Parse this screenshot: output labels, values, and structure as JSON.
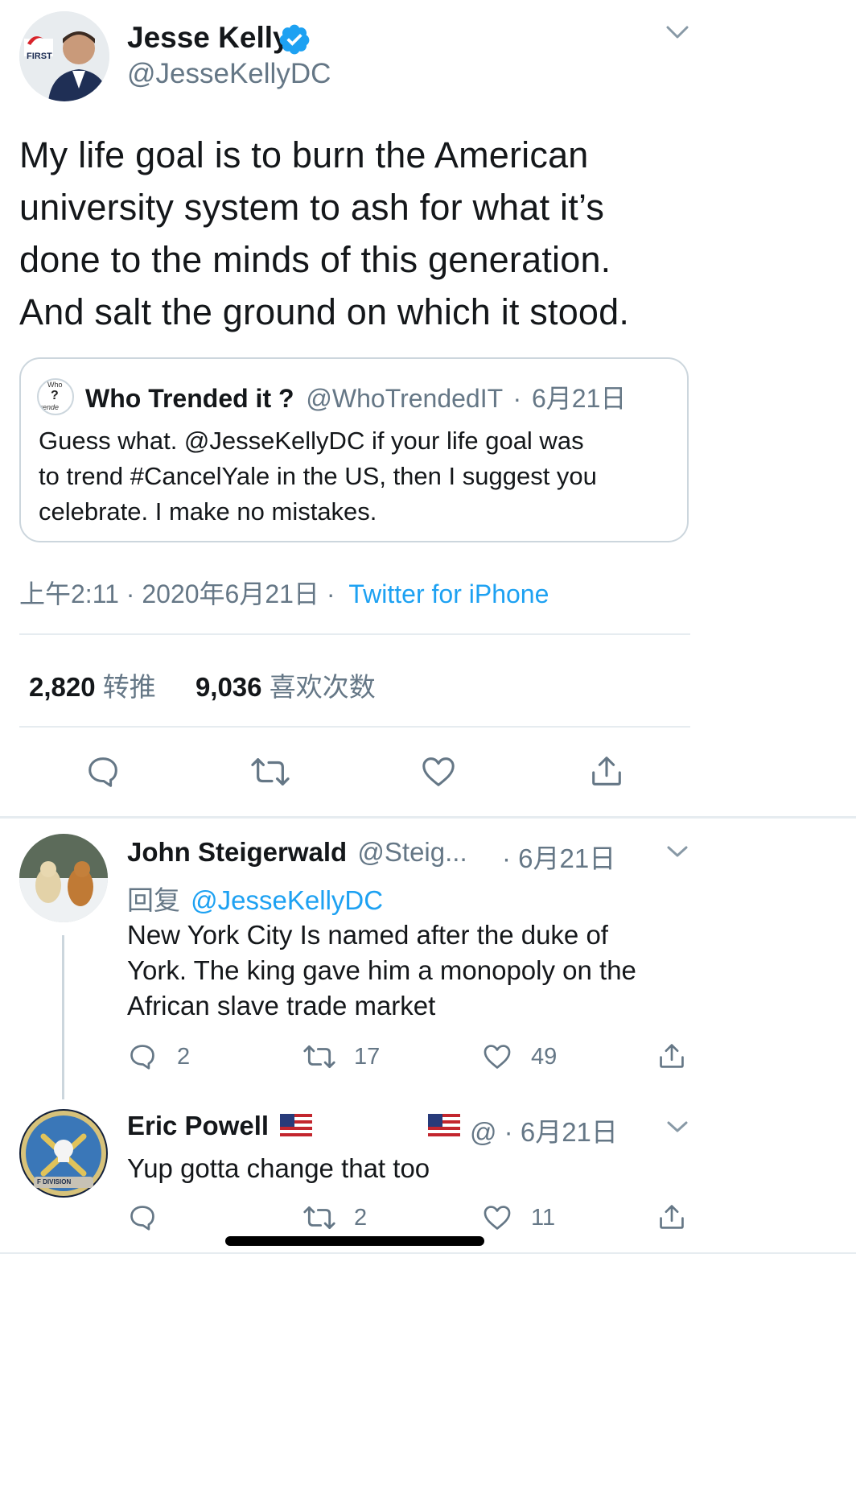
{
  "main_tweet": {
    "author_name": "Jesse Kelly",
    "author_handle": "@JesseKellyDC",
    "avatar_badge_text": "FIRST",
    "text_lines": [
      "My life goal is to burn the American",
      "university system to ash for what it’s",
      "done to the minds of this generation.",
      "And salt the ground on which it stood."
    ],
    "quoted": {
      "avatar_text_top": "Who",
      "avatar_text_mid": "?",
      "avatar_text_bot": "rende",
      "name": "Who Trended it ?",
      "handle": "@WhoTrendedIT",
      "separator": "·",
      "date": "6月21日",
      "text_lines": [
        "Guess what. @JesseKellyDC if your life goal was",
        "to trend #CancelYale in the US, then I suggest you",
        "celebrate. I make no mistakes."
      ]
    },
    "timestamp": "上午2:11 · 2020年6月21日 ·",
    "source": "Twitter for iPhone",
    "retweets_count": "2,820",
    "retweets_label": "转推",
    "likes_count": "9,036",
    "likes_label": "喜欢次数"
  },
  "replies": [
    {
      "name": "John Steigerwald",
      "handle": "@Steig...",
      "separator": "·",
      "date": "6月21日",
      "reply_prefix": "回复",
      "reply_to": "@JesseKellyDC",
      "text_lines": [
        "New York City Is named after the duke of",
        "York. The king gave him a monopoly on the",
        "African slave trade market"
      ],
      "replies_count": "2",
      "retweets_count": "17",
      "likes_count": "49"
    },
    {
      "name": "Eric Powell",
      "handle": "@",
      "separator": "·",
      "date": "6月21日",
      "avatar_text": "F DIVISION",
      "text_lines": [
        "Yup gotta change that too"
      ],
      "replies_count": "",
      "retweets_count": "2",
      "likes_count": "11"
    }
  ],
  "colors": {
    "accent": "#1da1f2",
    "text": "#14171a",
    "secondary": "#657786",
    "divider": "#e6ecf0",
    "verified": "#1da1f2"
  },
  "icons": [
    "chevron-down-icon",
    "verified-badge-icon",
    "reply-icon",
    "retweet-icon",
    "like-icon",
    "share-icon",
    "flag-us-icon"
  ]
}
